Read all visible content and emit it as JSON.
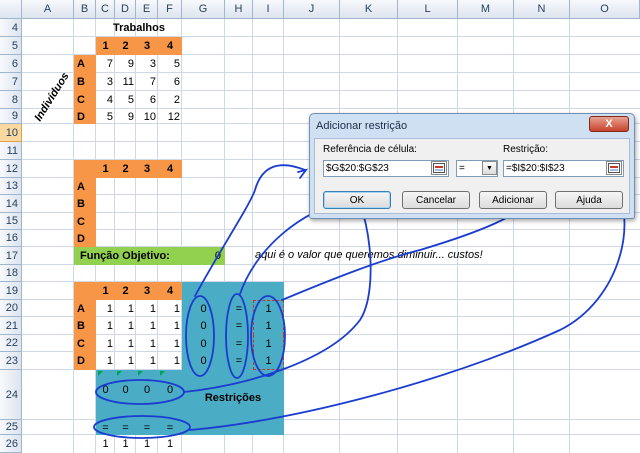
{
  "columns": [
    "A",
    "B",
    "C",
    "D",
    "E",
    "F",
    "G",
    "H",
    "I",
    "J",
    "K",
    "L",
    "M",
    "N",
    "O"
  ],
  "rows": [
    "4",
    "5",
    "6",
    "7",
    "8",
    "9",
    "10",
    "11",
    "12",
    "13",
    "14",
    "15",
    "16",
    "17",
    "18",
    "19",
    "20",
    "21",
    "22",
    "23",
    "24",
    "25",
    "26"
  ],
  "selected_row": "10",
  "sheet": {
    "trabalhos_label": "Trabalhos",
    "individuos_label": "Indivíduos",
    "header_nums": [
      "1",
      "2",
      "3",
      "4"
    ],
    "row_letters": [
      "A",
      "B",
      "C",
      "D"
    ],
    "cost_matrix": [
      [
        "7",
        "9",
        "3",
        "5"
      ],
      [
        "3",
        "11",
        "7",
        "6"
      ],
      [
        "4",
        "5",
        "6",
        "2"
      ],
      [
        "5",
        "9",
        "10",
        "12"
      ]
    ],
    "objective_label": "Função Objetivo:",
    "objective_value": "0",
    "note": "aqui é o valor que queremos diminuir... custos!",
    "solution_matrix": [
      [
        "1",
        "1",
        "1",
        "1"
      ],
      [
        "1",
        "1",
        "1",
        "1"
      ],
      [
        "1",
        "1",
        "1",
        "1"
      ],
      [
        "1",
        "1",
        "1",
        "1"
      ]
    ],
    "row_sums": [
      "0",
      "0",
      "0",
      "0"
    ],
    "equals": [
      "=",
      "=",
      "=",
      "="
    ],
    "row_rhs": [
      "1",
      "1",
      "1",
      "1"
    ],
    "col_sums": [
      "0",
      "0",
      "0",
      "0"
    ],
    "col_rhs": [
      "1",
      "1",
      "1",
      "1"
    ],
    "restricoes_label": "Restrições"
  },
  "dialog": {
    "title": "Adicionar restrição",
    "close_label": "X",
    "cell_ref_label": "Referência de célula:",
    "cell_ref_value": "$G$20:$G$23",
    "operator_value": "=",
    "constraint_label": "Restrição:",
    "constraint_value": "=$I$20:$I$23",
    "ok_label": "OK",
    "cancel_label": "Cancelar",
    "add_label": "Adicionar",
    "help_label": "Ajuda"
  },
  "colors": {
    "header_orange": "#f79646",
    "objective_green": "#92d050",
    "constraint_teal": "#4bacc6",
    "annotation_blue": "#1a3ccf"
  }
}
